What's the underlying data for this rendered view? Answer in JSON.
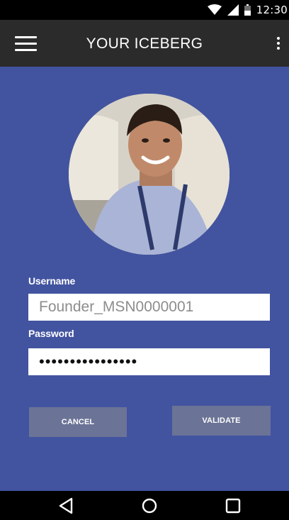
{
  "status_bar": {
    "time": "12:30",
    "icons": [
      "wifi-icon",
      "signal-icon",
      "battery-icon"
    ]
  },
  "app_bar": {
    "title": "YOUR ICEBERG",
    "menu_icon": "hamburger-menu-icon",
    "overflow_icon": "overflow-menu-icon"
  },
  "profile": {
    "avatar": "profile-photo"
  },
  "form": {
    "username_label": "Username",
    "username_value": "Founder_MSN0000001",
    "password_label": "Password",
    "password_value": "••••••••••••••••"
  },
  "actions": {
    "cancel_label": "CANCEL",
    "validate_label": "VALIDATE"
  },
  "nav_bar": {
    "icons": [
      "back-icon",
      "home-icon",
      "recents-icon"
    ]
  },
  "colors": {
    "background": "#4254a0",
    "app_bar": "#2b2b2b",
    "button": "#6b7396",
    "input": "#ffffff"
  }
}
